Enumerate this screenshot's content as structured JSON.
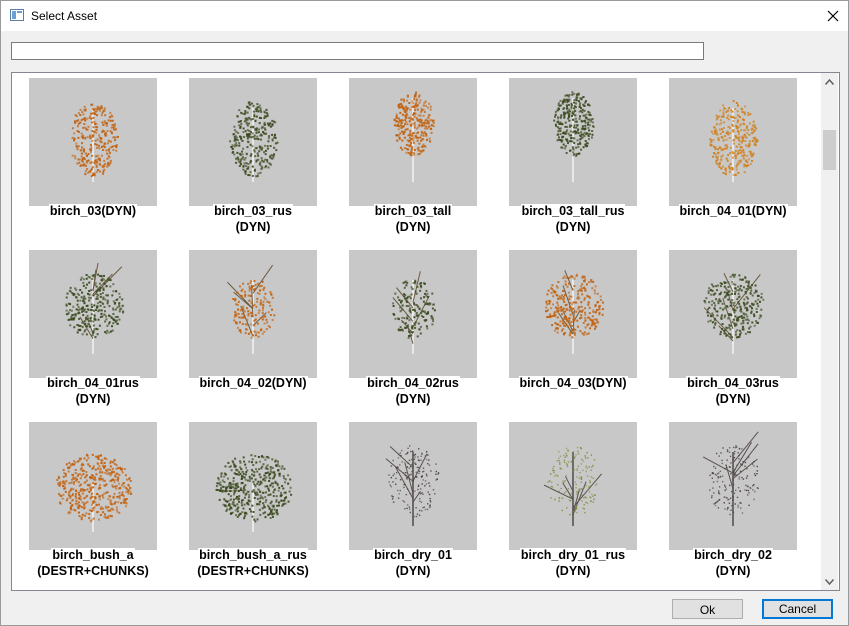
{
  "window": {
    "title": "Select Asset",
    "icon": "app-window-icon"
  },
  "search": {
    "value": "",
    "placeholder": ""
  },
  "assets": [
    {
      "line1": "birch_03(DYN)",
      "line2": "",
      "color": "#c2620f",
      "style": "tree"
    },
    {
      "line1": "birch_03_rus",
      "line2": "(DYN)",
      "color": "#3b4a1f",
      "style": "tree"
    },
    {
      "line1": "birch_03_tall",
      "line2": "(DYN)",
      "color": "#c2620f",
      "style": "tall"
    },
    {
      "line1": "birch_03_tall_rus",
      "line2": "(DYN)",
      "color": "#3b4a1f",
      "style": "tall"
    },
    {
      "line1": "birch_04_01(DYN)",
      "line2": "",
      "color": "#d0801a",
      "style": "tree"
    },
    {
      "line1": "birch_04_01rus",
      "line2": "(DYN)",
      "color": "#3d4d22",
      "style": "spread"
    },
    {
      "line1": "birch_04_02(DYN)",
      "line2": "",
      "color": "#c2620f",
      "style": "sparse"
    },
    {
      "line1": "birch_04_02rus",
      "line2": "(DYN)",
      "color": "#3d4d22",
      "style": "sparse"
    },
    {
      "line1": "birch_04_03(DYN)",
      "line2": "",
      "color": "#c2620f",
      "style": "spread"
    },
    {
      "line1": "birch_04_03rus",
      "line2": "(DYN)",
      "color": "#3d4d22",
      "style": "spread"
    },
    {
      "line1": "birch_bush_a",
      "line2": "(DESTR+CHUNKS)",
      "color": "#c2620f",
      "style": "bush"
    },
    {
      "line1": "birch_bush_a_rus",
      "line2": "(DESTR+CHUNKS)",
      "color": "#3b4a1f",
      "style": "bush"
    },
    {
      "line1": "birch_dry_01",
      "line2": "(DYN)",
      "color": "#4a4040",
      "style": "dry"
    },
    {
      "line1": "birch_dry_01_rus",
      "line2": "(DYN)",
      "color": "#7a8c3a",
      "style": "dry"
    },
    {
      "line1": "birch_dry_02",
      "line2": "(DYN)",
      "color": "#4a4040",
      "style": "dry2"
    }
  ],
  "buttons": {
    "ok": "Ok",
    "cancel": "Cancel"
  },
  "colors": {
    "thumb_bg": "#c8c8c8",
    "accent": "#0078d7"
  }
}
